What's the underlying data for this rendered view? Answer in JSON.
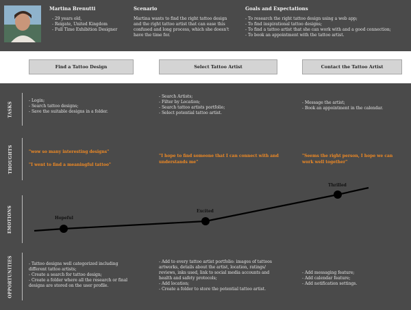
{
  "persona": {
    "name": "Martina Brenutti",
    "details": [
      "29 years old,",
      "Reigate, United Kingdom",
      "Full Time Exhibition Designer"
    ]
  },
  "scenario": {
    "heading": "Scenario",
    "text": "Martina wants to find the right tattoo design and the right tattoo artist that can ease this confused and long process, which she doesn't have the time for."
  },
  "goals": {
    "heading": "Goals and Expectations",
    "items": [
      "To research the right tattoo design using a web app;",
      "To find inspirational tattoo designs;",
      "To find a tattoo artist that she can work with and a good connection;",
      "To book an appointment with the tattoo artist."
    ]
  },
  "stages": [
    "Find a Tattoo Design",
    "Select Tattoo Artist",
    "Contact the Tattoo Artist"
  ],
  "rows": {
    "tasks": "TASKS",
    "thoughts": "THOUGHTS",
    "emotions": "EMOTIONS",
    "opportunities": "OPPORTUNITIES"
  },
  "tasks": [
    [
      "Login;",
      "Search tattoo designs;",
      "Save the suitable designs in a folder."
    ],
    [
      "Search Artists;",
      "Filter by Location;",
      "Search tattoo artists portfolio;",
      "Select potential tattoo artist."
    ],
    [
      "Message the artist;",
      "Book an appointment in the calendar."
    ]
  ],
  "thoughts": {
    "t1a": "\"wow so many interesting designs\"",
    "t1b": "\"I went to find a meaningful tattoo\"",
    "t2": "\"I hope to find someone that I can connect with and understands me\"",
    "t3": "\"Seems the right person, I hope we can work well together\""
  },
  "emotions": [
    "Hopeful",
    "Excited",
    "Thrilled"
  ],
  "opportunities": [
    [
      "Tattoo designs well categorized including different tattoo artists;",
      "Create a search for tattoo design;",
      "Create a folder where all the research or final designs are stored on the user profile."
    ],
    [
      "Add to every tattoo artist portfolio: images of tattoos artworks, details about the artist, location, ratings/ reviews, inks used, link to social media accounts and health and safety protocols;",
      "Add  location;",
      "Create a folder to store the potential tattoo artist."
    ],
    [
      "Add messaging feature;",
      "Add calendar feature;",
      "Add notification settings."
    ]
  ],
  "colors": {
    "background": "#4a4a4a",
    "thought": "#f08a24",
    "stage_button": "#d4d4d4"
  }
}
